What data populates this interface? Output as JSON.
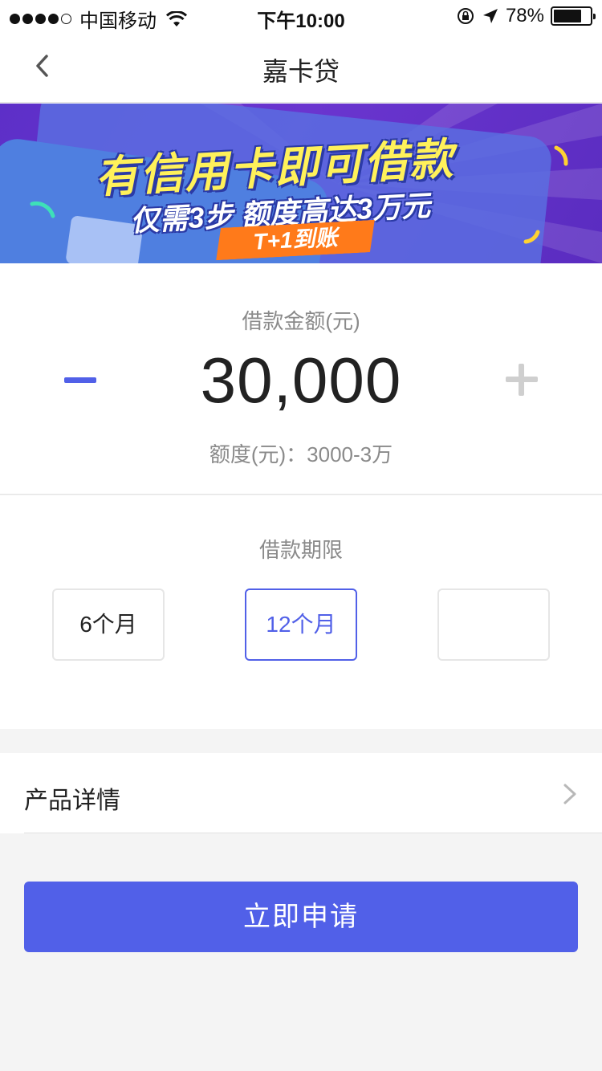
{
  "status_bar": {
    "carrier": "中国移动",
    "time": "下午10:00",
    "battery_percent": "78%",
    "battery_level": 0.78,
    "signal_icon": "signal-dots-icon",
    "wifi_icon": "wifi-icon",
    "rotation_lock_icon": "rotation-lock-icon",
    "location_icon": "location-arrow-icon"
  },
  "nav": {
    "title": "嘉卡贷",
    "back_icon": "chevron-left-icon"
  },
  "banner": {
    "line1": "有信用卡即可借款",
    "line2": "仅需3步 额度高达3万元",
    "tag": "T+1到账"
  },
  "amount": {
    "label": "借款金额(元)",
    "value": "30,000",
    "range_text": "额度(元)：3000-3万",
    "minus_icon": "minus-icon",
    "plus_icon": "plus-icon"
  },
  "term": {
    "label": "借款期限",
    "options": [
      {
        "label": "6个月",
        "selected": false
      },
      {
        "label": "12个月",
        "selected": true
      },
      {
        "label": "",
        "selected": false
      }
    ]
  },
  "details": {
    "label": "产品详情",
    "chevron_icon": "chevron-right-icon"
  },
  "apply": {
    "label": "立即申请"
  },
  "colors": {
    "accent": "#5160e8",
    "banner_bg": "#6a35cf",
    "banner_yellow": "#fff15a",
    "banner_tag": "#ff7a1a",
    "page_bg": "#f4f4f4"
  }
}
